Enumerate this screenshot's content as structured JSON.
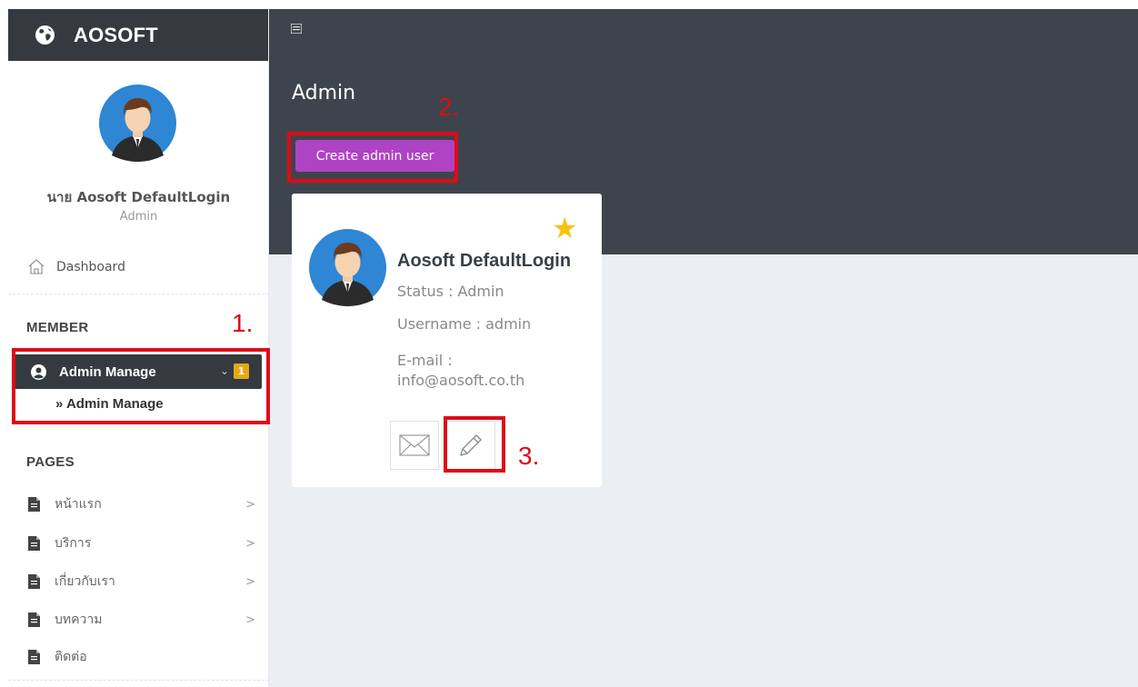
{
  "brand": {
    "name": "AOSOFT",
    "icon": "globe-icon"
  },
  "sidebar": {
    "profile": {
      "name": "นาย Aosoft DefaultLogin",
      "role": "Admin"
    },
    "dashboard": {
      "label": "Dashboard",
      "icon": "home-icon"
    },
    "member_section": "MEMBER",
    "member_menu": {
      "label": "Admin Manage",
      "badge": "1",
      "chevron": "⌄",
      "icon": "user-circle-icon"
    },
    "member_submenu": "» Admin Manage",
    "pages_section": "PAGES",
    "pages": [
      {
        "label": "หน้าแรก",
        "arrow": ">"
      },
      {
        "label": "บริการ",
        "arrow": ">"
      },
      {
        "label": "เกี่ยวกับเรา",
        "arrow": ">"
      },
      {
        "label": "บทความ",
        "arrow": ">"
      },
      {
        "label": "ติดต่อ"
      }
    ]
  },
  "main": {
    "title": "Admin",
    "create_button": "Create admin user",
    "card": {
      "name": "Aosoft DefaultLogin",
      "status": "Status : Admin",
      "username": "Username : admin",
      "email_label": "E-mail :",
      "email_value": "info@aosoft.co.th",
      "star": "★"
    }
  },
  "annotations": {
    "one": "1.",
    "two": "2.",
    "three": "3."
  },
  "colors": {
    "sidebar_dark": "#343a40",
    "header_dark": "#3e444d",
    "content_bg": "#ebeef3",
    "button_purple": "#b042c4",
    "badge_gold": "#e6a817",
    "star_gold": "#f6c20c",
    "annotation_red": "#dd0b16"
  }
}
